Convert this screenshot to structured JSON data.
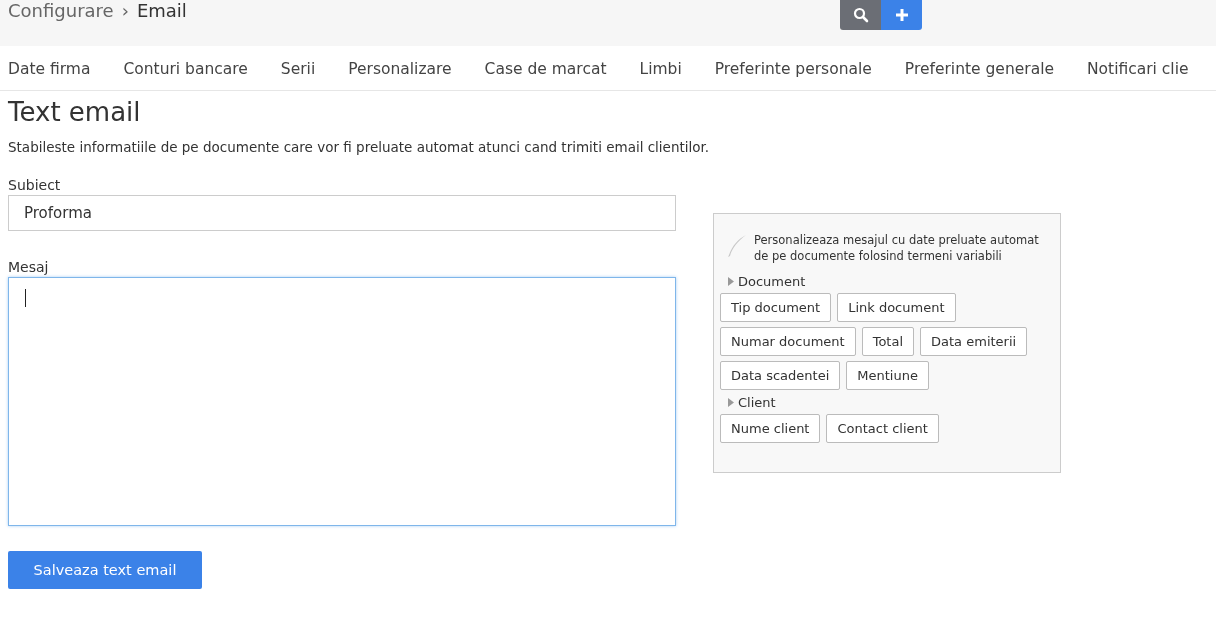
{
  "breadcrumb": {
    "parent": "Configurare",
    "separator": "›",
    "current": "Email"
  },
  "header_buttons": [
    {
      "kind": "search"
    },
    {
      "kind": "add"
    }
  ],
  "tabs": [
    "Date firma",
    "Conturi bancare",
    "Serii",
    "Personalizare",
    "Case de marcat",
    "Limbi",
    "Preferinte personale",
    "Preferinte generale",
    "Notificari clie"
  ],
  "page": {
    "title": "Text email",
    "description": "Stabileste informatiile de pe documente care vor fi preluate automat atunci cand trimiti email clientilor."
  },
  "form": {
    "subject": {
      "label": "Subiect",
      "value": "Proforma"
    },
    "message": {
      "label": "Mesaj",
      "focused": true
    },
    "submit": "Salveaza text email"
  },
  "variables_panel": {
    "hint": "Personalizeaza mesajul cu date preluate automat de pe documente folosind termeni variabili",
    "groups": [
      {
        "title": "Document",
        "expanded": false,
        "rows": [
          [
            "Tip document",
            "Link document"
          ],
          [
            "Numar document",
            "Total",
            "Data emiterii"
          ],
          [
            "Data scadentei",
            "Mentiune"
          ]
        ]
      },
      {
        "title": "Client",
        "expanded": false,
        "rows": [
          [
            "Nume client",
            "Contact client"
          ]
        ]
      }
    ]
  }
}
